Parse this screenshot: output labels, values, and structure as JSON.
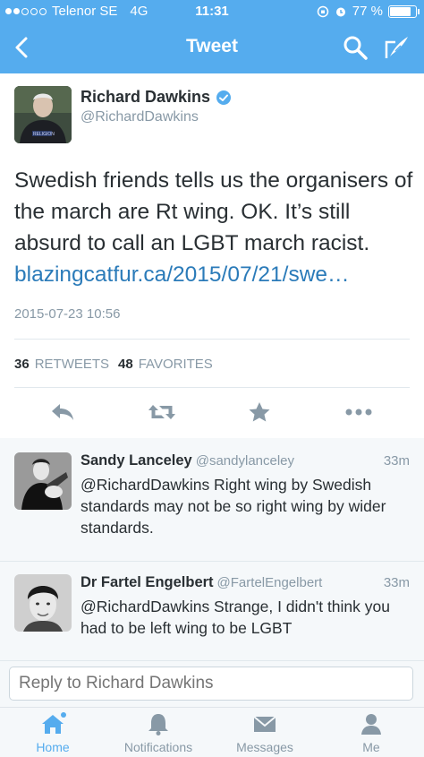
{
  "status_bar": {
    "carrier": "Telenor SE",
    "network": "4G",
    "time": "11:31",
    "battery_percent": "77 %",
    "battery_level": 0.77
  },
  "nav": {
    "title": "Tweet"
  },
  "tweet": {
    "author_name": "Richard Dawkins",
    "author_handle": "@RichardDawkins",
    "text": "Swedish friends tells us the organisers of the march are Rt wing. OK. It’s still absurd to call an LGBT march racist.",
    "link": "blazingcatfur.ca/2015/07/21/swe…",
    "timestamp": "2015-07-23 10:56",
    "retweets_count": "36",
    "retweets_label": "RETWEETS",
    "favorites_count": "48",
    "favorites_label": "FAVORITES"
  },
  "replies": [
    {
      "name": "Sandy Lanceley",
      "handle": "@sandylanceley",
      "time": "33m",
      "text": "@RichardDawkins Right wing by Swedish standards may not be so right wing by wider standards."
    },
    {
      "name": "Dr Fartel Engelbert",
      "handle": "@FartelEngelbert",
      "time": "33m",
      "text": "@RichardDawkins Strange, I didn't think you had to be left wing to be LGBT"
    }
  ],
  "reply_box": {
    "placeholder": "Reply to Richard Dawkins"
  },
  "tabs": [
    {
      "label": "Home",
      "icon": "home-icon",
      "active": true
    },
    {
      "label": "Notifications",
      "icon": "bell-icon",
      "active": false
    },
    {
      "label": "Messages",
      "icon": "envelope-icon",
      "active": false
    },
    {
      "label": "Me",
      "icon": "person-icon",
      "active": false
    }
  ],
  "colors": {
    "brand": "#55acee",
    "link": "#2b7bb9",
    "muted": "#8899a6"
  }
}
